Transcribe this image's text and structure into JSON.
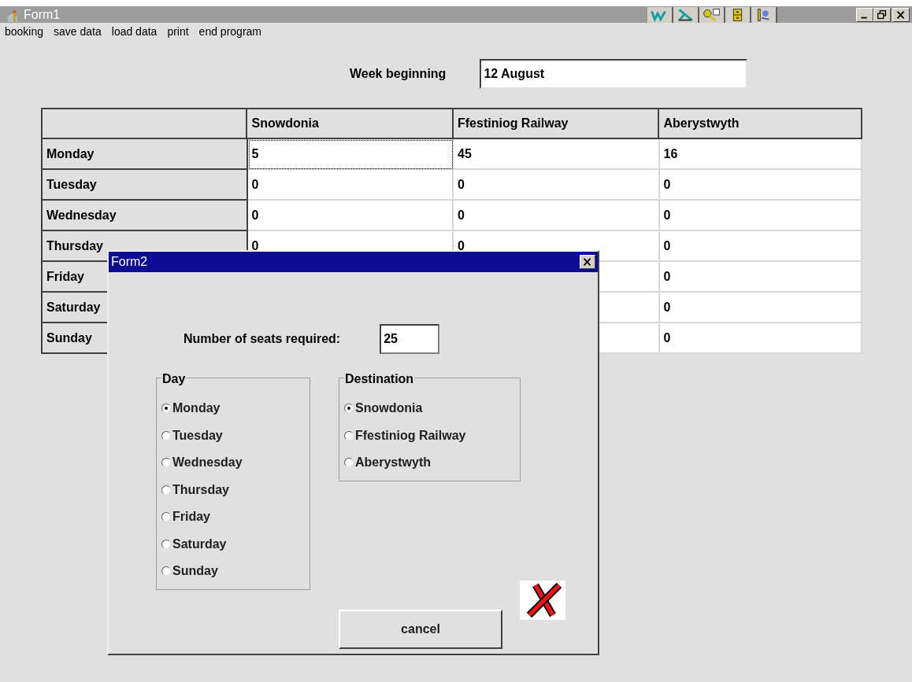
{
  "window": {
    "title": "Form1"
  },
  "menu": [
    "booking",
    "save data",
    "load data",
    "print",
    "end program"
  ],
  "week": {
    "label": "Week beginning",
    "value": "12 August"
  },
  "grid": {
    "columns": [
      "Snowdonia",
      "Ffestiniog Railway",
      "Aberystwyth"
    ],
    "rows": [
      {
        "day": "Monday",
        "cells": [
          {
            "value": "5",
            "focused": true
          },
          {
            "value": "45",
            "focused": false
          },
          {
            "value": "16",
            "focused": false
          }
        ]
      },
      {
        "day": "Tuesday",
        "cells": [
          {
            "value": "0",
            "focused": false
          },
          {
            "value": "0",
            "focused": false
          },
          {
            "value": "0",
            "focused": false
          }
        ]
      },
      {
        "day": "Wednesday",
        "cells": [
          {
            "value": "0",
            "focused": false
          },
          {
            "value": "0",
            "focused": false
          },
          {
            "value": "0",
            "focused": false
          }
        ]
      },
      {
        "day": "Thursday",
        "cells": [
          {
            "value": "0",
            "focused": false
          },
          {
            "value": "0",
            "focused": false
          },
          {
            "value": "0",
            "focused": false
          }
        ]
      },
      {
        "day": "Friday",
        "cells": [
          null,
          null,
          {
            "value": "0",
            "focused": false
          }
        ]
      },
      {
        "day": "Saturday",
        "cells": [
          null,
          null,
          {
            "value": "0",
            "focused": false
          }
        ]
      },
      {
        "day": "Sunday",
        "cells": [
          null,
          null,
          {
            "value": "0",
            "focused": false
          }
        ]
      }
    ]
  },
  "dialog": {
    "title": "Form2",
    "seats": {
      "label": "Number of seats required:",
      "value": "25"
    },
    "day_group": {
      "label": "Day",
      "options": [
        {
          "label": "Monday",
          "selected": true
        },
        {
          "label": "Tuesday",
          "selected": false
        },
        {
          "label": "Wednesday",
          "selected": false
        },
        {
          "label": "Thursday",
          "selected": false
        },
        {
          "label": "Friday",
          "selected": false
        },
        {
          "label": "Saturday",
          "selected": false
        },
        {
          "label": "Sunday",
          "selected": false
        }
      ]
    },
    "destination_group": {
      "label": "Destination",
      "options": [
        {
          "label": "Snowdonia",
          "selected": true
        },
        {
          "label": "Ffestiniog Railway",
          "selected": false
        },
        {
          "label": "Aberystwyth",
          "selected": false
        }
      ]
    },
    "cancel_button": "cancel"
  }
}
